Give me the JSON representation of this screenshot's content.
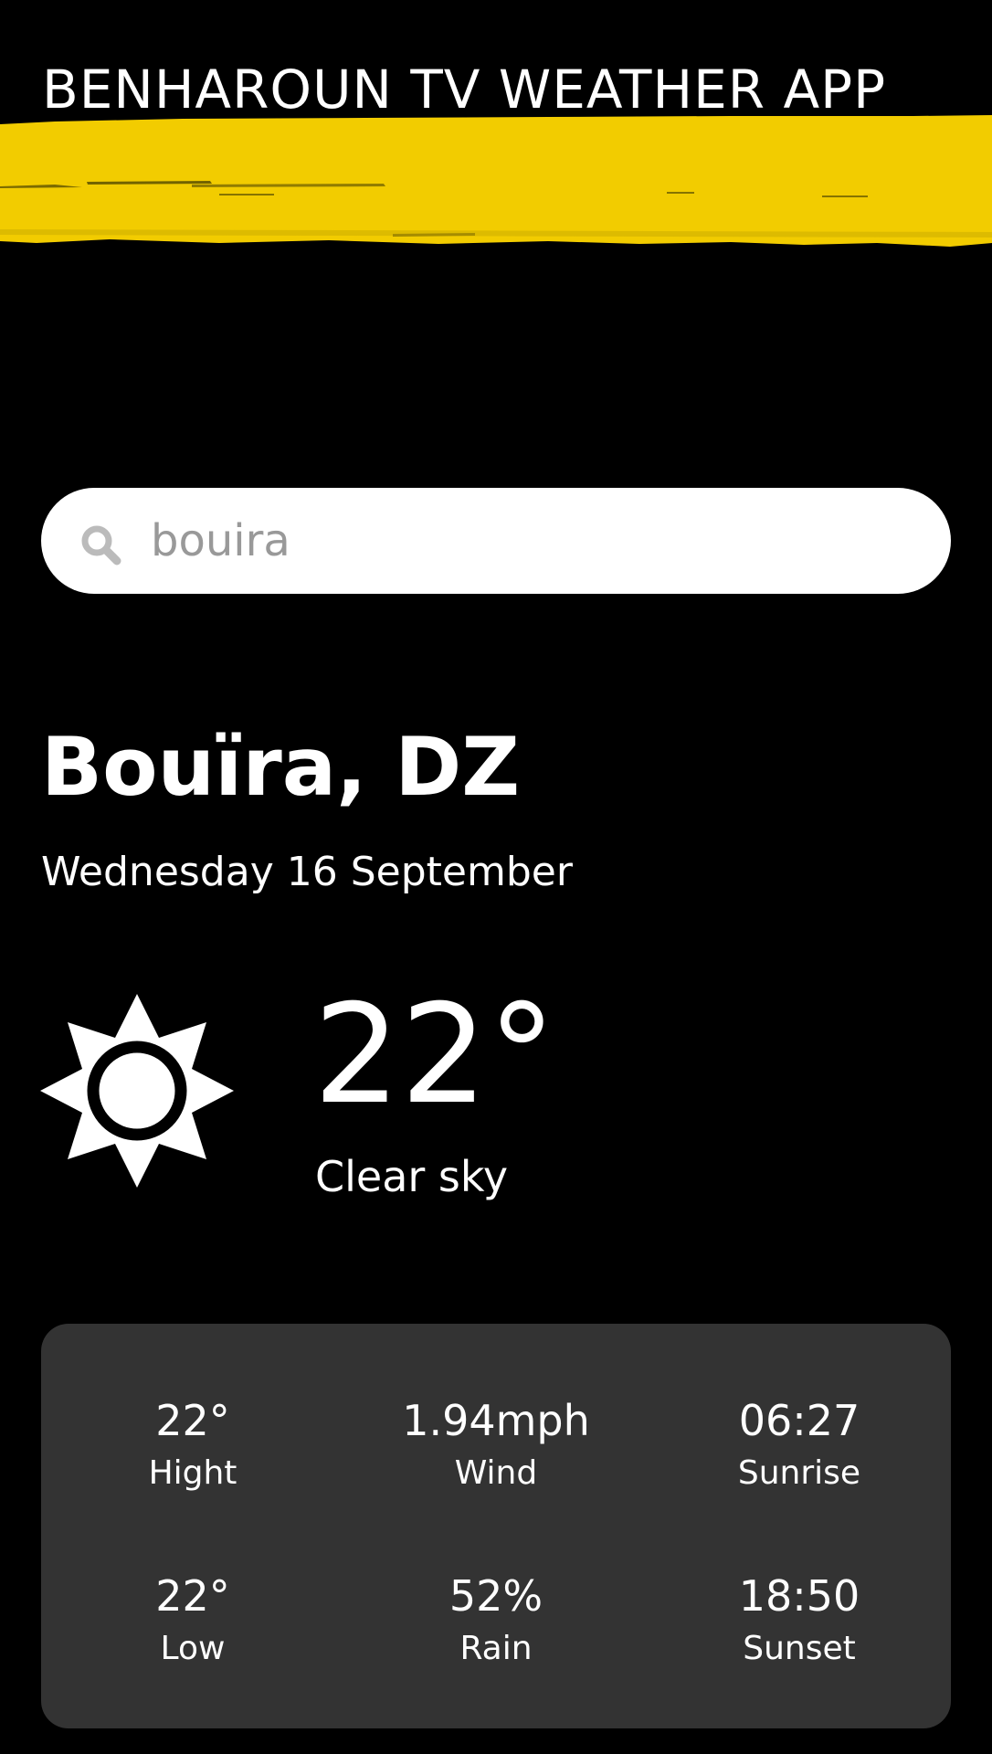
{
  "header": {
    "title": "BENHAROUN TV WEATHER APP",
    "stripe_color": "#F2CC00"
  },
  "search": {
    "value": "bouira",
    "placeholder": "",
    "icon": "search-icon"
  },
  "location": {
    "city": "Bouïra, DZ",
    "date": "Wednesday 16 September"
  },
  "current": {
    "icon": "sun-icon",
    "temperature": "22°",
    "condition": "Clear sky"
  },
  "stats": [
    {
      "value": "22°",
      "label": "Hight"
    },
    {
      "value": "1.94mph",
      "label": "Wind"
    },
    {
      "value": "06:27",
      "label": "Sunrise"
    },
    {
      "value": "22°",
      "label": "Low"
    },
    {
      "value": "52%",
      "label": "Rain"
    },
    {
      "value": "18:50",
      "label": "Sunset"
    }
  ],
  "colors": {
    "background": "#000000",
    "panel": "#333333",
    "text": "#FFFFFF",
    "search_text": "#999999"
  }
}
